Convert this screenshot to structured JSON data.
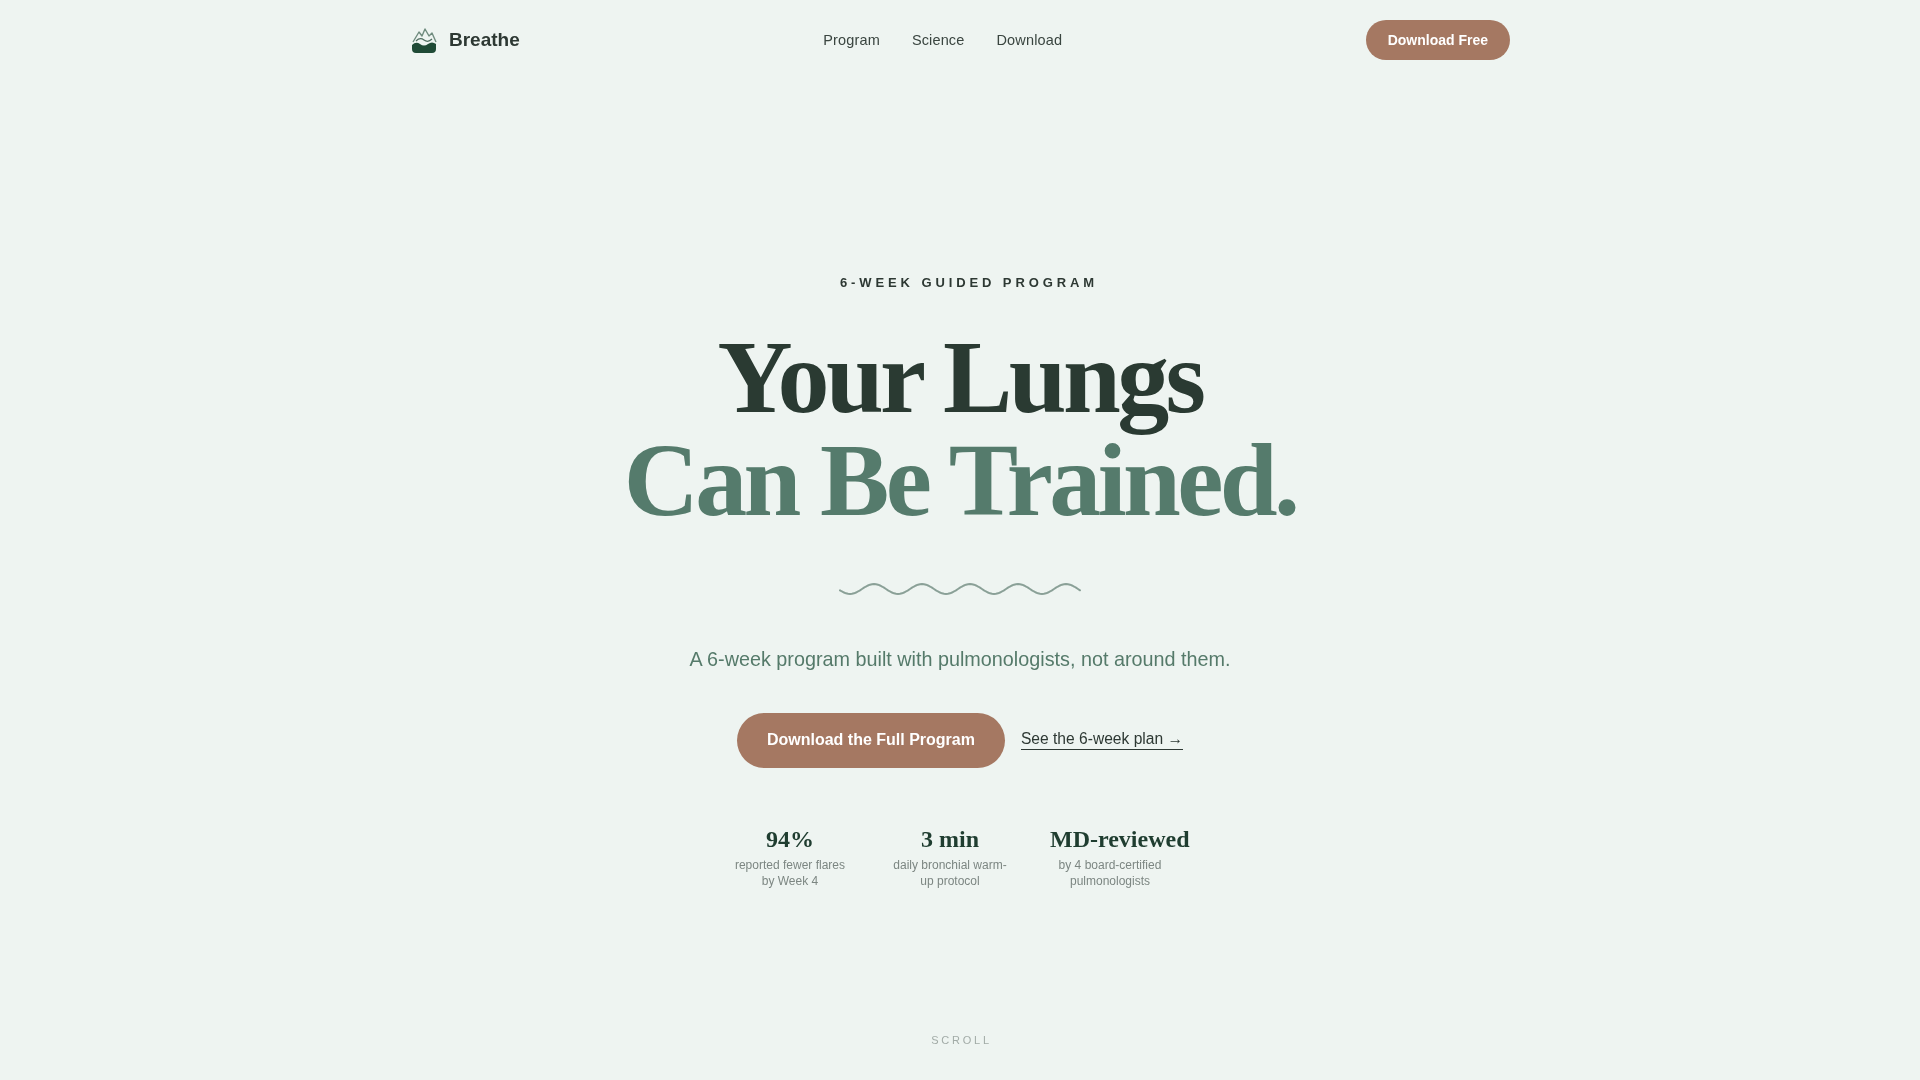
{
  "header": {
    "brand": "Breathe",
    "nav": [
      "Program",
      "Science",
      "Download"
    ],
    "cta": "Download Free"
  },
  "hero": {
    "eyebrow": "6-WEEK GUIDED PROGRAM",
    "title_lines": [
      {
        "text": "Your Lungs",
        "kind": "plain"
      },
      {
        "text": "Can Be Trained.",
        "kind": "accent"
      }
    ],
    "subtitle": "A 6-week program built with pulmonologists, not around them.",
    "primary_button": "Download the Full Program",
    "secondary_link": "See the 6-week plan →",
    "stats": [
      {
        "value": "94%",
        "label": "reported fewer flares by Week 4"
      },
      {
        "value": "3 min",
        "label": "daily bronchial warm-up protocol"
      },
      {
        "value": "MD-reviewed",
        "label": "by 4 board-certified pulmonologists"
      }
    ]
  },
  "scroll_hint": "SCROLL"
}
